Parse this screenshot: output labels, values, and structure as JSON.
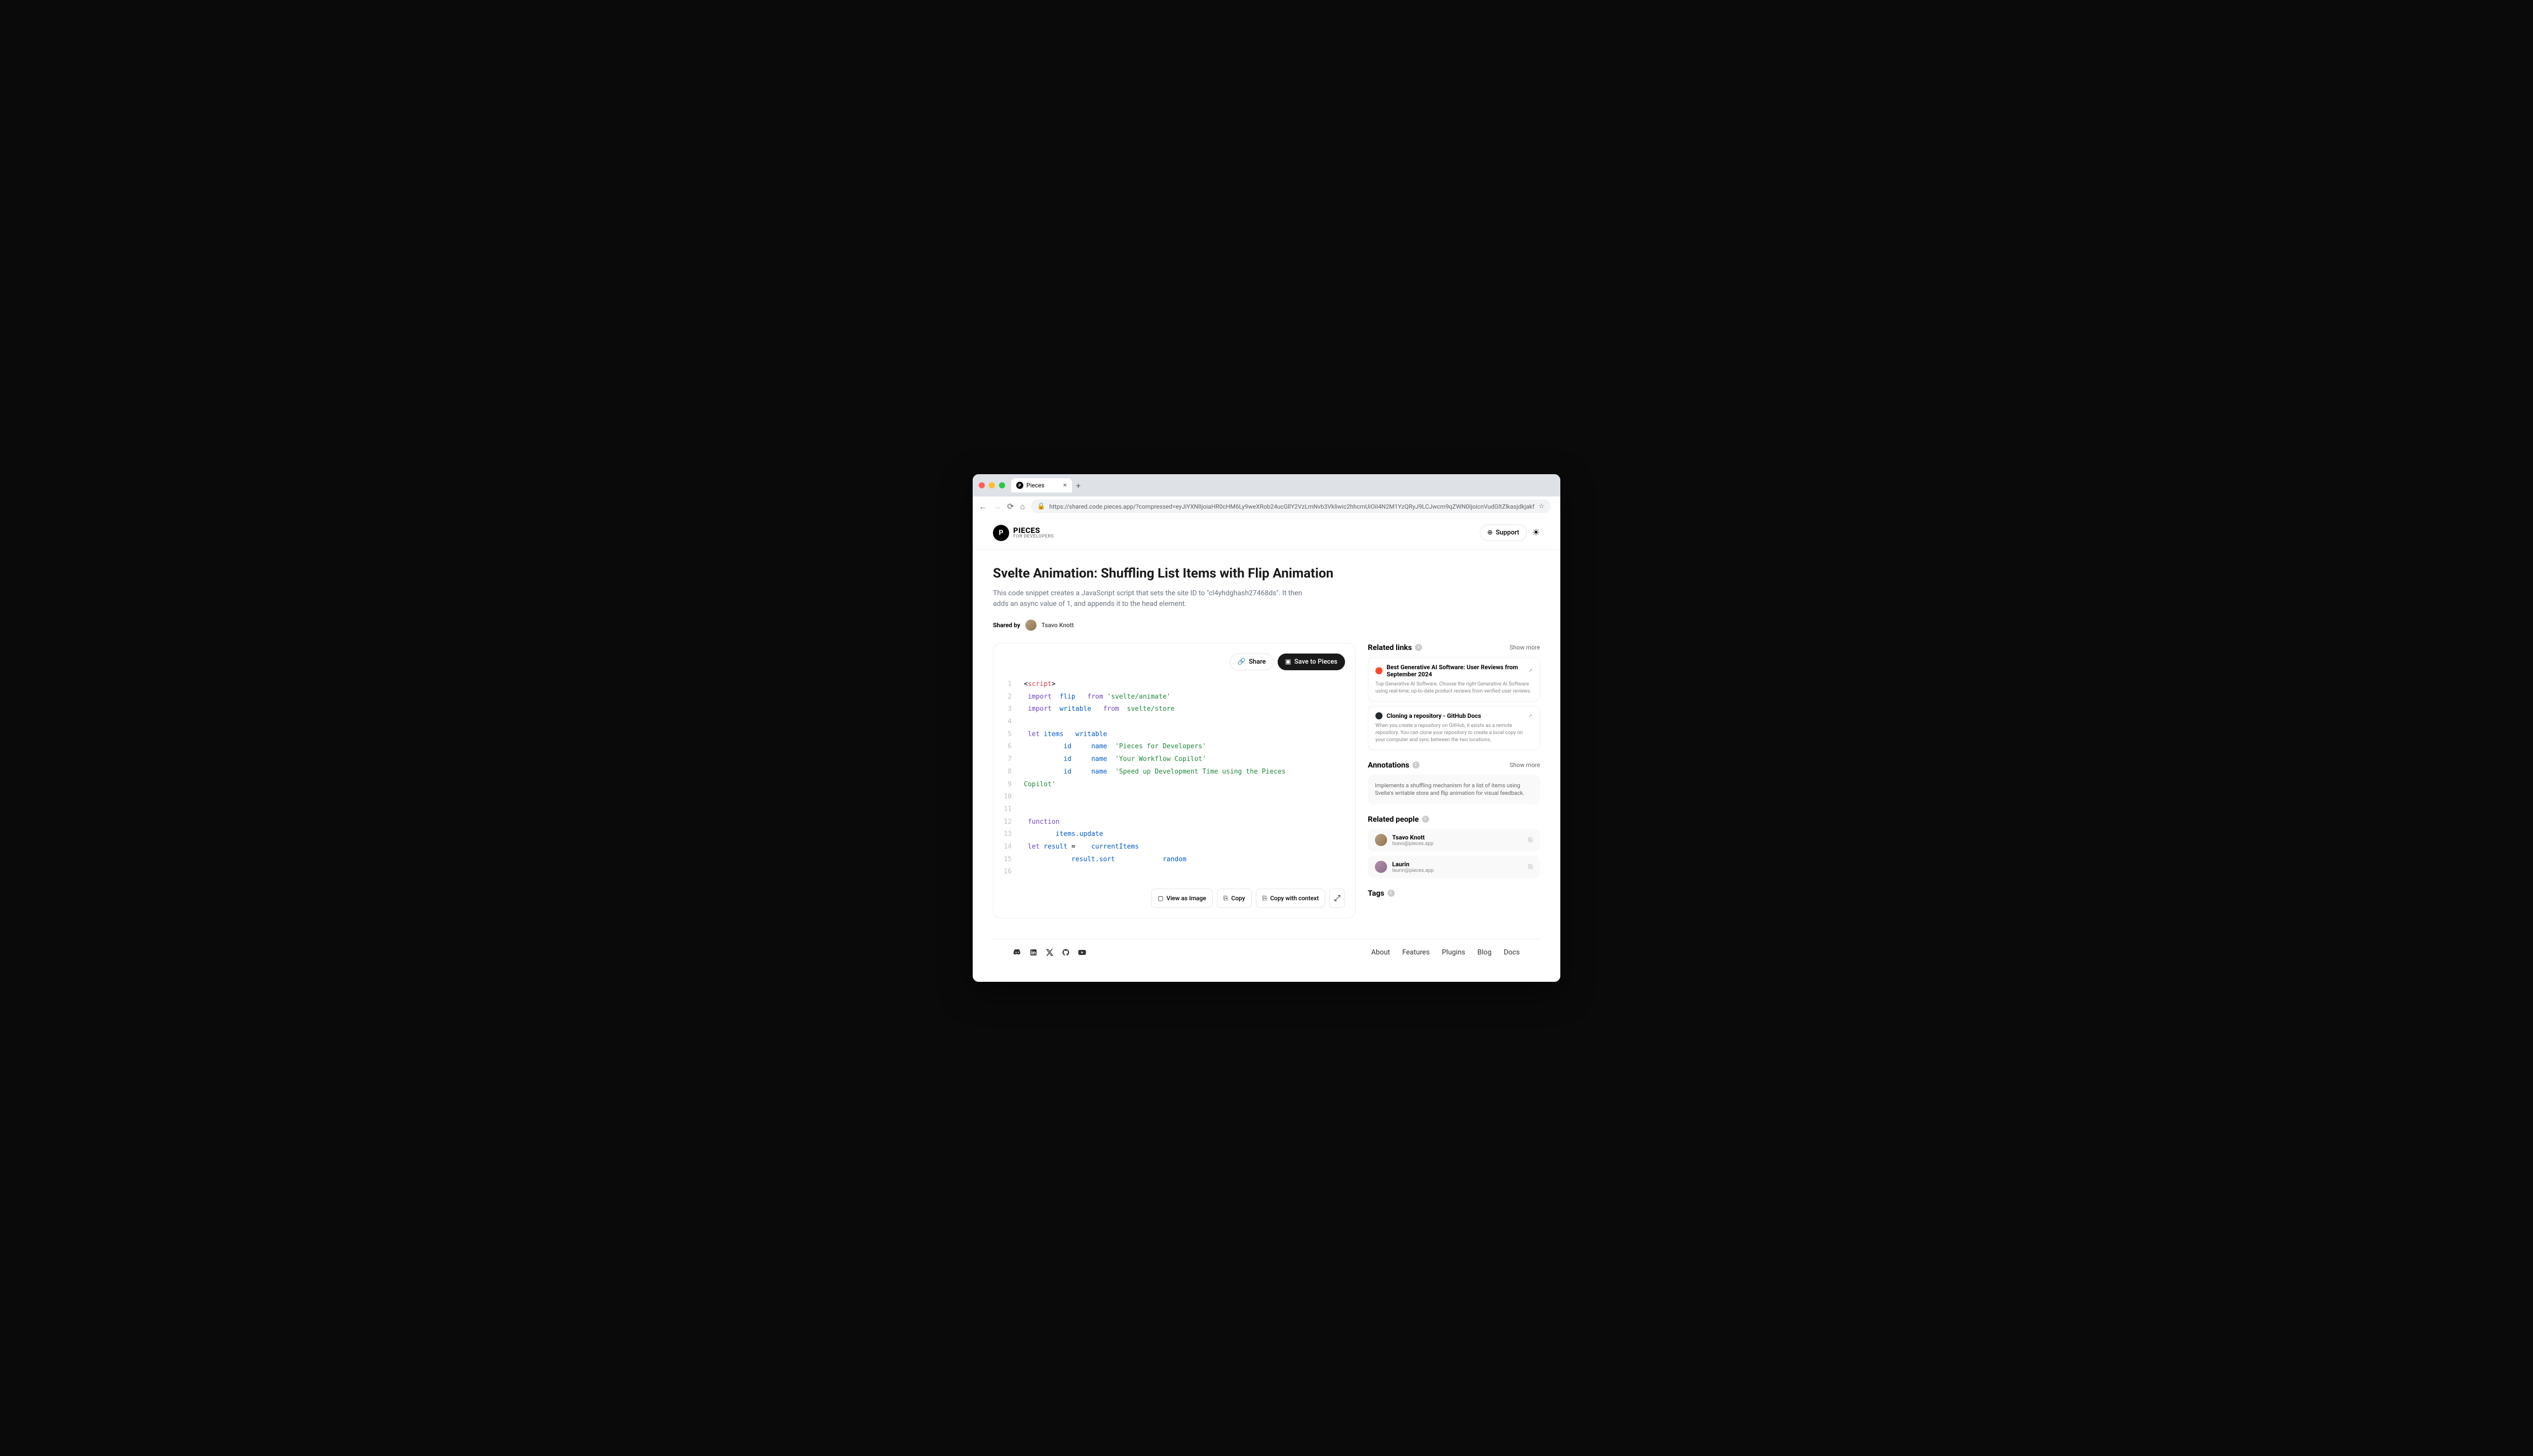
{
  "browser": {
    "tab_title": "Pieces",
    "url": "https://shared.code.pieces.app/?compressed=eyJiYXNlIjoiaHR0cHM6Ly9weXRob24ucGllY2VzLmNvb3Vkliwic2hhcmUiOiI4N2M1YzQRyJ9LCJwcm9qZWN0IjoicnVudGltZlkasjdkjakf"
  },
  "header": {
    "logo_title": "PIECES",
    "logo_sub": "FOR DEVELOPERS",
    "support_label": "Support"
  },
  "page": {
    "title": "Svelte Animation: Shuffling List Items with Flip Animation",
    "description": "This code snippet creates a JavaScript script that sets the site ID to \"cl4yhdghash27468ds\". It then adds an async value of 1, and appends it to the head element.",
    "shared_by_label": "Shared by",
    "author": "Tsavo Knott"
  },
  "actions": {
    "share": "Share",
    "save": "Save to Pieces",
    "view_image": "View as Image",
    "copy": "Copy",
    "copy_context": "Copy with context"
  },
  "code": {
    "lines": [
      {
        "num": "1",
        "tokens": [
          {
            "t": "<",
            "c": ""
          },
          {
            "t": "script",
            "c": "tok-red"
          },
          {
            "t": ">",
            "c": ""
          }
        ]
      },
      {
        "num": "2",
        "tokens": [
          {
            "t": " import",
            "c": "tok-purple"
          },
          {
            "t": "  ",
            "c": ""
          },
          {
            "t": "flip",
            "c": "tok-blue"
          },
          {
            "t": "   ",
            "c": ""
          },
          {
            "t": "from",
            "c": "tok-purple"
          },
          {
            "t": " ",
            "c": ""
          },
          {
            "t": "'svelte/animate'",
            "c": "tok-green"
          }
        ]
      },
      {
        "num": "3",
        "tokens": [
          {
            "t": " import",
            "c": "tok-purple"
          },
          {
            "t": "  ",
            "c": ""
          },
          {
            "t": "writable",
            "c": "tok-blue"
          },
          {
            "t": "   ",
            "c": ""
          },
          {
            "t": "from",
            "c": "tok-purple"
          },
          {
            "t": "  ",
            "c": ""
          },
          {
            "t": "svelte/store",
            "c": "tok-green"
          }
        ]
      },
      {
        "num": "4",
        "tokens": []
      },
      {
        "num": "5",
        "tokens": [
          {
            "t": " let",
            "c": "tok-purple"
          },
          {
            "t": " ",
            "c": ""
          },
          {
            "t": "items",
            "c": "tok-blue"
          },
          {
            "t": "   ",
            "c": ""
          },
          {
            "t": "writable",
            "c": "tok-blue"
          }
        ]
      },
      {
        "num": "6",
        "tokens": [
          {
            "t": "          id",
            "c": "tok-blue"
          },
          {
            "t": "     ",
            "c": ""
          },
          {
            "t": "name",
            "c": "tok-blue"
          },
          {
            "t": "  ",
            "c": ""
          },
          {
            "t": "'Pieces for Developers'",
            "c": "tok-green"
          }
        ]
      },
      {
        "num": "7",
        "tokens": [
          {
            "t": "          id",
            "c": "tok-blue"
          },
          {
            "t": "     ",
            "c": ""
          },
          {
            "t": "name",
            "c": "tok-blue"
          },
          {
            "t": "  ",
            "c": ""
          },
          {
            "t": "'Your Workflow Copilot'",
            "c": "tok-green"
          }
        ]
      },
      {
        "num": "8",
        "tokens": [
          {
            "t": "          id",
            "c": "tok-blue"
          },
          {
            "t": "     ",
            "c": ""
          },
          {
            "t": "name",
            "c": "tok-blue"
          },
          {
            "t": "  ",
            "c": ""
          },
          {
            "t": "'Speed up Development Time using the Pieces ",
            "c": "tok-green"
          }
        ]
      },
      {
        "num": "9",
        "tokens": [
          {
            "t": "Copilot'",
            "c": "tok-green"
          }
        ]
      },
      {
        "num": "10",
        "tokens": []
      },
      {
        "num": "11",
        "tokens": []
      },
      {
        "num": "12",
        "tokens": [
          {
            "t": " function",
            "c": "tok-purple"
          }
        ]
      },
      {
        "num": "13",
        "tokens": [
          {
            "t": "        items.update",
            "c": "tok-blue"
          }
        ]
      },
      {
        "num": "14",
        "tokens": [
          {
            "t": " let",
            "c": "tok-purple"
          },
          {
            "t": " ",
            "c": ""
          },
          {
            "t": "result",
            "c": "tok-blue"
          },
          {
            "t": " =    ",
            "c": ""
          },
          {
            "t": "currentItems",
            "c": "tok-blue"
          }
        ]
      },
      {
        "num": "15",
        "tokens": [
          {
            "t": "            result.sort",
            "c": "tok-blue"
          },
          {
            "t": "            ",
            "c": ""
          },
          {
            "t": "random",
            "c": "tok-blue"
          }
        ]
      },
      {
        "num": "16",
        "tokens": []
      }
    ]
  },
  "related_links": {
    "title": "Related links",
    "show_more": "Show more",
    "items": [
      {
        "title": "Best Generative AI Software: User Reviews from September 2024",
        "desc": "Top Generative AI Software. Choose the right Generative AI Software using real-time, up-to-date product reviews from verified user reviews."
      },
      {
        "title": "Cloning a repository - GitHub Docs",
        "desc": "When you create a repository on GitHub, it exists as a remote repository. You can clone your repository to create a local copy on your computer and sync between the two locations."
      }
    ]
  },
  "annotations": {
    "title": "Annotations",
    "show_more": "Show more",
    "text": "Implements a shuffling mechanism for a list of items using Svelte's writable store and flip animation for visual feedback."
  },
  "related_people": {
    "title": "Related people",
    "items": [
      {
        "name": "Tsavo Knott",
        "email": "tsavo@pieces.app"
      },
      {
        "name": "Laurin",
        "email": "laurin@pieces.app"
      }
    ]
  },
  "tags": {
    "title": "Tags"
  },
  "footer": {
    "links": [
      "About",
      "Features",
      "Plugins",
      "Blog",
      "Docs"
    ]
  }
}
